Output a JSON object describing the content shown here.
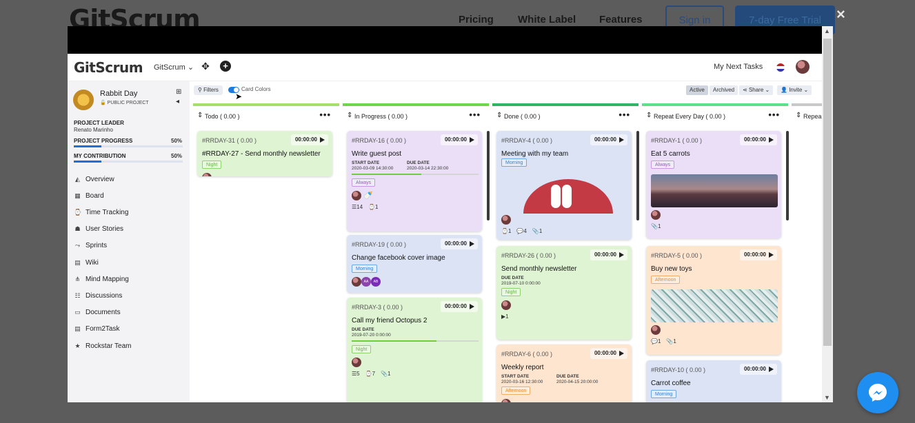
{
  "site": {
    "logo": "GitScrum",
    "nav": [
      "Pricing",
      "White Label",
      "Features"
    ],
    "sign_in": "Sign in",
    "trial": "7-day Free Trial",
    "close": "×"
  },
  "app": {
    "logo": "GitScrum",
    "workspace": "GitScrum ⌄",
    "next_tasks": "My Next Tasks"
  },
  "sidebar": {
    "project_name": "Rabbit Day",
    "project_visibility": "PUBLIC PROJECT",
    "leader_label": "PROJECT LEADER",
    "leader_name": "Renato Marinho",
    "progress_label": "PROJECT PROGRESS",
    "progress_value": "50%",
    "progress_fraction": 0.5,
    "contribution_label": "MY CONTRIBUTION",
    "contribution_value": "50%",
    "contribution_fraction": 0.5,
    "items": [
      {
        "label": "Overview",
        "icon": "overview-icon"
      },
      {
        "label": "Board",
        "icon": "board-icon"
      },
      {
        "label": "Time Tracking",
        "icon": "time-tracking-icon"
      },
      {
        "label": "User Stories",
        "icon": "user-stories-icon"
      },
      {
        "label": "Sprints",
        "icon": "sprints-icon"
      },
      {
        "label": "Wiki",
        "icon": "wiki-icon"
      },
      {
        "label": "Mind Mapping",
        "icon": "mind-mapping-icon"
      },
      {
        "label": "Discussions",
        "icon": "discussions-icon"
      },
      {
        "label": "Documents",
        "icon": "documents-icon"
      },
      {
        "label": "Form2Task",
        "icon": "form2task-icon"
      },
      {
        "label": "Rockstar Team",
        "icon": "rockstar-team-icon"
      }
    ]
  },
  "toolbar": {
    "filters": "Filters",
    "card_colors": "Card Colors",
    "active": "Active",
    "archived": "Archived",
    "share": "Share ⌄",
    "invite": "Invite ⌄"
  },
  "columns": [
    {
      "title": "Todo ( 0.00 )",
      "color": "#a5e06a",
      "cards": [
        {
          "id": "#RRDAY-31 ( 0.00 )",
          "timer": "00:00:00",
          "title": "#RRDAY-27 - Send monthly newsletter",
          "tag": "Night",
          "bg": "#dff4d3"
        }
      ]
    },
    {
      "title": "In Progress ( 0.00 )",
      "color": "#6fd64a",
      "cards": [
        {
          "id": "#RRDAY-16 ( 0.00 )",
          "timer": "00:00:00",
          "title": "Write guest post",
          "start_label": "START DATE",
          "start": "2020-03-09 14:30:00",
          "due_label": "DUE DATE",
          "due": "2020-03-14 22:30:00",
          "progress": 0.55,
          "tag": "Always",
          "meta": [
            "14",
            "1"
          ],
          "bg": "#eadff6"
        },
        {
          "id": "#RRDAY-19 ( 0.00 )",
          "timer": "00:00:00",
          "title": "Change facebook cover image",
          "tag": "Morning",
          "bg": "#dbe3f5"
        },
        {
          "id": "#RRDAY-3 ( 0.00 )",
          "timer": "00:00:00",
          "title": "Call my friend Octopus 2",
          "due_label": "DUE DATE",
          "due": "2019-07-20 0:00:00",
          "progress": 0.67,
          "tag": "Night",
          "meta": [
            "5",
            "7",
            "1"
          ],
          "bg": "#dff4d3"
        }
      ]
    },
    {
      "title": "Done ( 0.00 )",
      "color": "#2fb464",
      "cards": [
        {
          "id": "#RRDAY-4 ( 0.00 )",
          "timer": "00:00:00",
          "title": "Meeting with my team",
          "tag": "Morning",
          "meta": [
            "1",
            "4",
            "1"
          ],
          "bg": "#dbe3f5"
        },
        {
          "id": "#RRDAY-26 ( 0.00 )",
          "timer": "00:00:00",
          "title": "Send monthly newsletter",
          "due_label": "DUE DATE",
          "due": "2019-07-10 0:00:00",
          "tag": "Night",
          "meta": [
            "1"
          ],
          "bg": "#dff4d3"
        },
        {
          "id": "#RRDAY-6 ( 0.00 )",
          "timer": "00:00:00",
          "title": "Weekly report",
          "start_label": "START DATE",
          "start": "2020-03-16 12:30:00",
          "due_label": "DUE DATE",
          "due": "2020-04-15 20:00:00",
          "tag": "Afternoon",
          "bg": "#fde5d0"
        }
      ]
    },
    {
      "title": "Repeat Every Day ( 0.00 )",
      "color": "#5de08a",
      "cards": [
        {
          "id": "#RRDAY-1 ( 0.00 )",
          "timer": "00:00:00",
          "title": "Eat 5 carrots",
          "tag": "Always",
          "meta": [
            "1"
          ],
          "bg": "#eadff6"
        },
        {
          "id": "#RRDAY-5 ( 0.00 )",
          "timer": "00:00:00",
          "title": "Buy new toys",
          "tag": "Afternoon",
          "meta": [
            "1",
            "1"
          ],
          "bg": "#fde5d0"
        },
        {
          "id": "#RRDAY-10 ( 0.00 )",
          "timer": "00:00:00",
          "title": "Carrot coffee",
          "tag": "Morning",
          "bg": "#dbe3f5"
        }
      ]
    },
    {
      "title": "Repea",
      "color": "#c8c8c8",
      "cards": []
    }
  ]
}
